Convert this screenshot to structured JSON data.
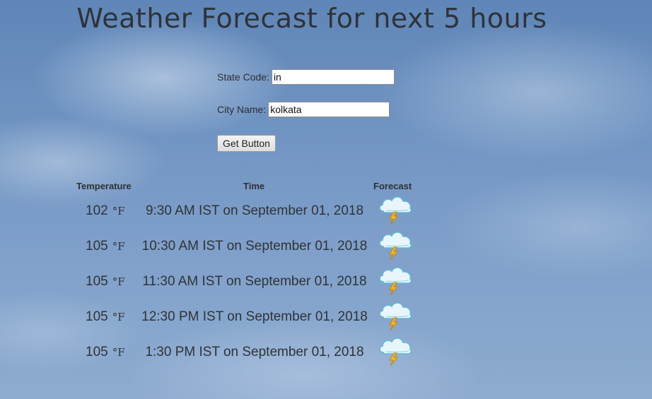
{
  "title": "Weather Forecast for next 5 hours",
  "form": {
    "state_label": "State Code:",
    "state_value": "in",
    "city_label": "City Name:",
    "city_value": "kolkata",
    "button_label": "Get Button"
  },
  "table": {
    "headers": {
      "temperature": "Temperature",
      "time": "Time",
      "forecast": "Forecast"
    },
    "unit": "°F",
    "rows": [
      {
        "temp": "102",
        "time": "9:30 AM IST on September 01, 2018",
        "icon": "thunderstorm-icon"
      },
      {
        "temp": "105",
        "time": "10:30 AM IST on September 01, 2018",
        "icon": "thunderstorm-icon"
      },
      {
        "temp": "105",
        "time": "11:30 AM IST on September 01, 2018",
        "icon": "thunderstorm-icon"
      },
      {
        "temp": "105",
        "time": "12:30 PM IST on September 01, 2018",
        "icon": "thunderstorm-icon"
      },
      {
        "temp": "105",
        "time": "1:30 PM IST on September 01, 2018",
        "icon": "thunderstorm-icon"
      }
    ]
  },
  "colors": {
    "sky": "#6f93c1",
    "text": "#2f3337",
    "cloud": "#e8f6fb",
    "bolt": "#f5b82a"
  }
}
